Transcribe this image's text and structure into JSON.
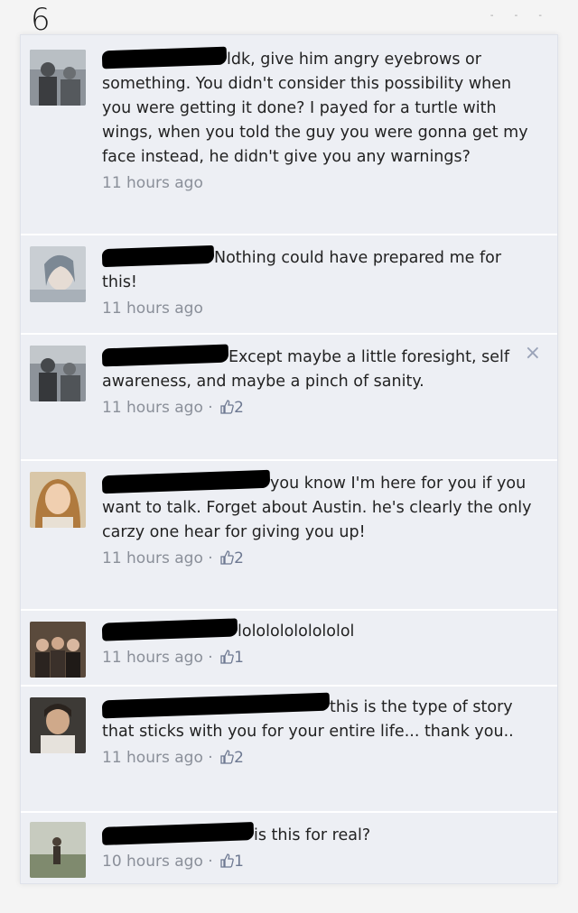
{
  "page_label": "6",
  "corner_marks": "- - -",
  "comments": [
    {
      "text": "ldk, give him angry eyebrows or something. You didn't consider this possibility when you were getting it done? I payed for a turtle with wings, when you told the guy you were gonna get my face instead, he didn't give you any warnings?",
      "time": "11 hours ago",
      "likes": ""
    },
    {
      "text": "Nothing could have prepared me for this!",
      "time": "11 hours ago",
      "likes": ""
    },
    {
      "text": "Except maybe a little foresight, self awareness, and maybe a pinch of sanity.",
      "time": "11 hours ago",
      "likes": "2",
      "close": "×"
    },
    {
      "text": "you know I'm here for you if you want to talk. Forget about Austin. he's clearly the only carzy one hear for giving you up!",
      "time": "11 hours ago",
      "likes": "2"
    },
    {
      "text": "lolololololololol",
      "time": "11 hours ago",
      "likes": "1"
    },
    {
      "text": "this is the type of story that sticks with you for your entire life... thank you..",
      "time": "11 hours ago",
      "likes": "2"
    },
    {
      "text": "is this for real?",
      "time": "10 hours ago",
      "likes": "1"
    }
  ],
  "separator": " · ",
  "icons": {
    "like": "thumbs-up-icon",
    "close": "close-icon"
  }
}
